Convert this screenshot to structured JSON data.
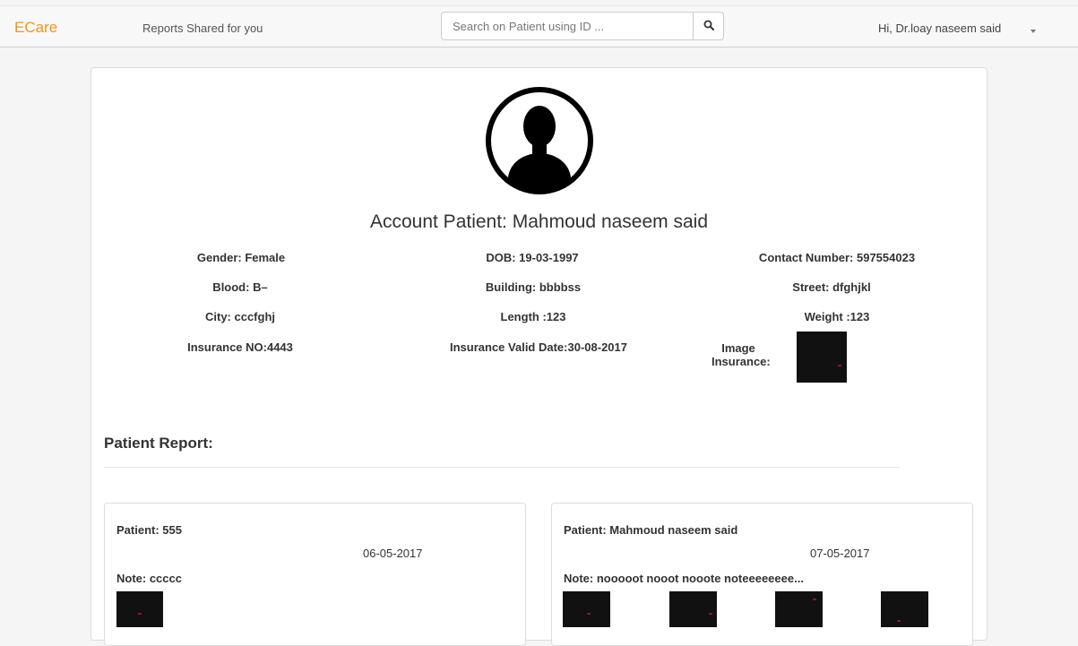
{
  "header": {
    "brand": "ECare",
    "nav_link": "Reports Shared for you",
    "search_placeholder": "Search on Patient using ID ...",
    "greeting": "Hi, Dr.loay naseem said"
  },
  "patient": {
    "title": "Account Patient: Mahmoud naseem said",
    "gender": "Gender: Female",
    "dob": "DOB: 19-03-1997",
    "contact": "Contact Number: 597554023",
    "blood": "Blood: B–",
    "building": "Building: bbbbss",
    "street": "Street: dfghjkl",
    "city": "City: cccfghj",
    "length": "Length :123",
    "weight": "Weight :123",
    "insurance_no": "Insurance NO:4443",
    "insurance_valid": "Insurance Valid Date:30-08-2017",
    "image_insurance_line1": "Image",
    "image_insurance_line2": "Insurance:"
  },
  "reports": {
    "heading": "Patient Report:",
    "items": [
      {
        "patient": "Patient: 555",
        "date": "06-05-2017",
        "note": "Note: ccccc",
        "image_count": 1
      },
      {
        "patient": "Patient: Mahmoud naseem said",
        "date": "07-05-2017",
        "note": "Note: nooooot nooot nooote noteeeeeeee...",
        "image_count": 4
      }
    ]
  },
  "icons": {
    "search": "search-icon",
    "caret": "caret-down-icon",
    "avatar": "user-avatar-icon"
  },
  "colors": {
    "brand": "#f0961a",
    "navbar_bg": "#f8f8f8",
    "thumb": "#111111"
  }
}
